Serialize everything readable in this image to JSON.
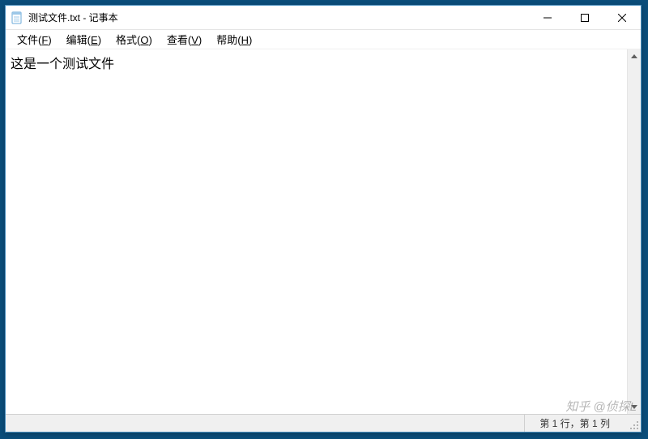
{
  "window": {
    "title": "测试文件.txt - 记事本"
  },
  "menu": {
    "file": {
      "label": "文件",
      "accel": "F"
    },
    "edit": {
      "label": "编辑",
      "accel": "E"
    },
    "format": {
      "label": "格式",
      "accel": "O"
    },
    "view": {
      "label": "查看",
      "accel": "V"
    },
    "help": {
      "label": "帮助",
      "accel": "H"
    }
  },
  "editor": {
    "content": "这是一个测试文件"
  },
  "status": {
    "position": "第 1 行，第 1 列"
  },
  "watermark": "知乎 @侦探L"
}
